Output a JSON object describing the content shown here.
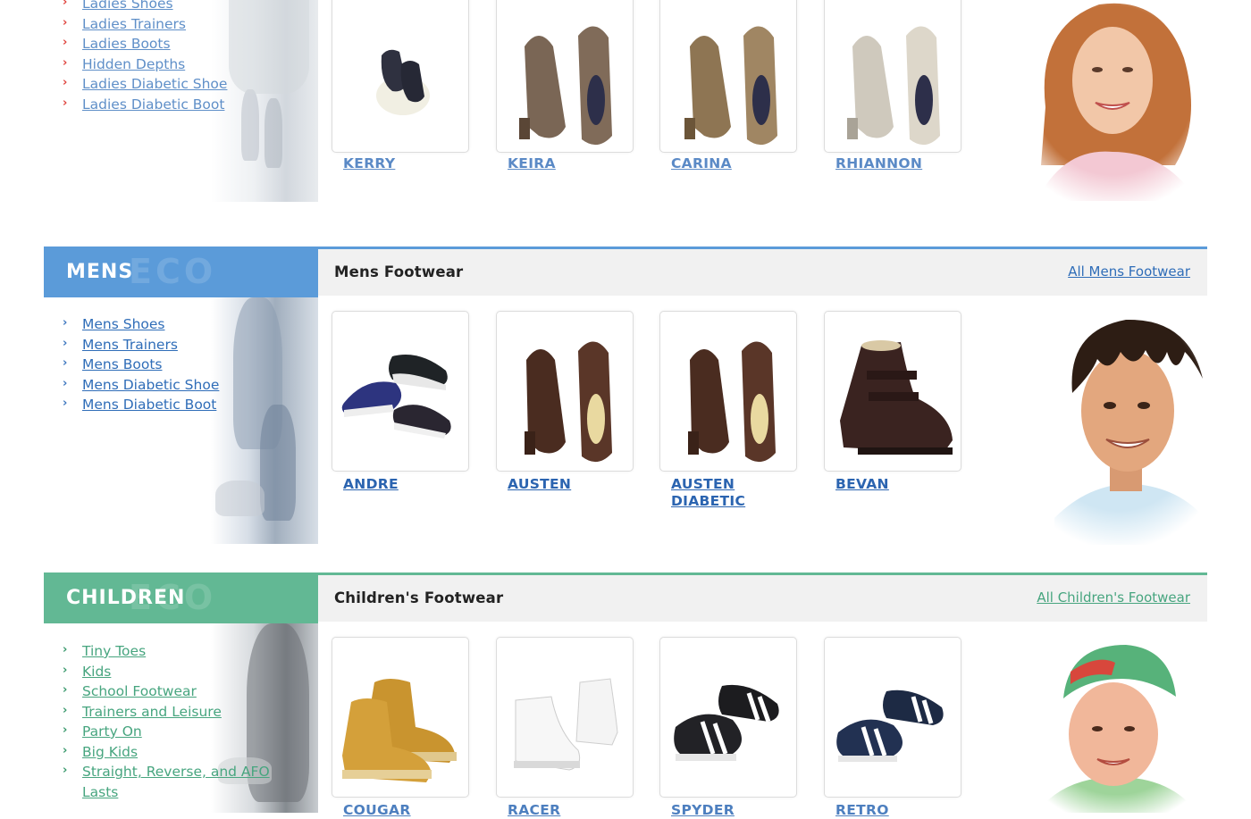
{
  "ladies": {
    "categories": [
      "Ladies Shoes",
      "Ladies Trainers",
      "Ladies Boots",
      "Hidden Depths",
      "Ladies Diabetic Shoe",
      "Ladies Diabetic Boot"
    ],
    "products": [
      "KERRY",
      "KEIRA",
      "CARINA",
      "RHIANNON"
    ]
  },
  "mens": {
    "heading": "MENS",
    "heading_ghost": "ECO",
    "bar_title": "Mens Footwear",
    "bar_link": "All Mens Footwear",
    "categories": [
      "Mens Shoes",
      "Mens Trainers",
      "Mens Boots",
      "Mens Diabetic Shoe",
      "Mens Diabetic Boot"
    ],
    "products": [
      "ANDRE",
      "AUSTEN",
      "AUSTEN DIABETIC",
      "BEVAN"
    ]
  },
  "children": {
    "heading": "CHILDREN",
    "heading_ghost": "ECO",
    "bar_title": "Children's Footwear",
    "bar_link": "All Children's Footwear",
    "categories": [
      "Tiny Toes",
      "Kids",
      "School Footwear",
      "Trainers and Leisure",
      "Party On",
      "Big Kids",
      "Straight, Reverse, and AFO Lasts"
    ],
    "products": [
      "COUGAR",
      "RACER",
      "SPYDER",
      "RETRO"
    ]
  },
  "colors": {
    "mens_accent": "#5b9bd9",
    "children_accent": "#62b894",
    "ladies_arrow": "#e0453f"
  },
  "icons": {
    "list_arrow": "›"
  }
}
